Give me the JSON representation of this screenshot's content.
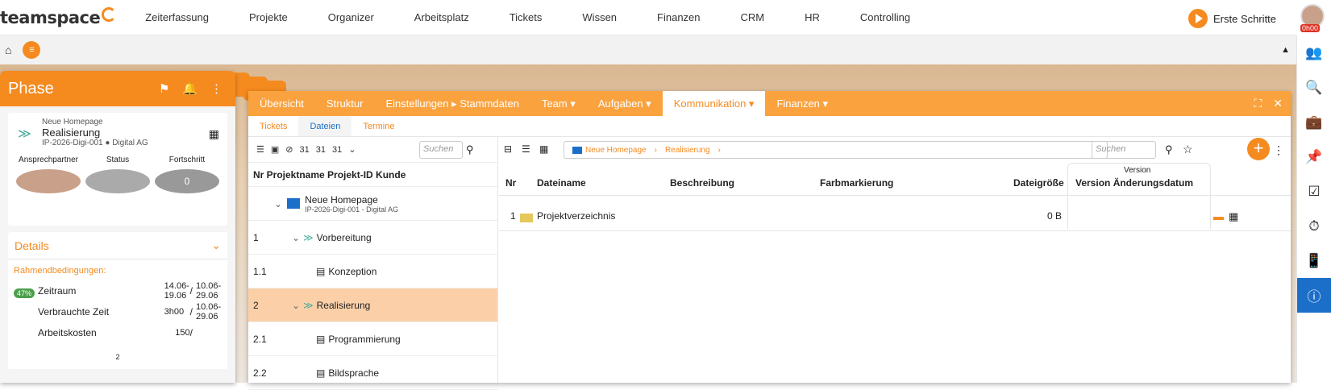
{
  "app": {
    "logo": "teamspace"
  },
  "nav": [
    "Zeiterfassung",
    "Projekte",
    "Organizer",
    "Arbeitsplatz",
    "Tickets",
    "Wissen",
    "Finanzen",
    "CRM",
    "HR",
    "Controlling"
  ],
  "erste_schritte": "Erste Schritte",
  "user_badge": "0h00",
  "phase": {
    "title": "Phase",
    "project": "Neue Homepage",
    "name": "Realisierung",
    "id_line": "IP-2026-Digi-001 ● Digital AG",
    "col_ansprech": "Ansprechpartner",
    "col_status": "Status",
    "col_fortschritt": "Fortschritt",
    "fortschritt_value": "0",
    "details": "Details",
    "rahmen": "Rahmendbedingungen:",
    "pill": "47%",
    "rows": [
      {
        "label": "Zeitraum",
        "v1": "14.06-\n19.06",
        "sep": "/",
        "v2": "10.06-\n29.06"
      },
      {
        "label": "Verbrauchte Zeit",
        "v1": "3h00",
        "sep": "/",
        "v2": "10.06-\n29.06"
      },
      {
        "label": "Arbeitskosten",
        "v1": "150",
        "sep": "/",
        "v2": ""
      }
    ],
    "footer_num": "2"
  },
  "tabs": [
    "Übersicht",
    "Struktur",
    "Einstellungen ▸ Stammdaten",
    "Team ▾",
    "Aufgaben ▾",
    "Kommunikation ▾",
    "Finanzen ▾"
  ],
  "subtabs": [
    "Tickets",
    "Dateien",
    "Termine"
  ],
  "search_placeholder": "Suchen",
  "tree_header": "Nr  Projektname Projekt-ID Kunde",
  "tree_root": {
    "name": "Neue Homepage",
    "id": "IP-2026-Digi-001 - Digital AG"
  },
  "tree": [
    {
      "nr": "1",
      "name": "Vorbereitung"
    },
    {
      "nr": "1.1",
      "name": "Konzeption"
    },
    {
      "nr": "2",
      "name": "Realisierung"
    },
    {
      "nr": "2.1",
      "name": "Programmierung"
    },
    {
      "nr": "2.2",
      "name": "Bildsprache"
    }
  ],
  "breadcrumb": [
    "Neue Homepage",
    "Realisierung"
  ],
  "files_cols": {
    "nr": "Nr",
    "name": "Dateiname",
    "desc": "Beschreibung",
    "color": "Farbmarkierung",
    "size": "Dateigröße",
    "version_group": "Version",
    "version_date": "Version Änderungsdatum"
  },
  "files": [
    {
      "nr": "1",
      "name": "Projektverzeichnis",
      "size": "0 B"
    }
  ]
}
